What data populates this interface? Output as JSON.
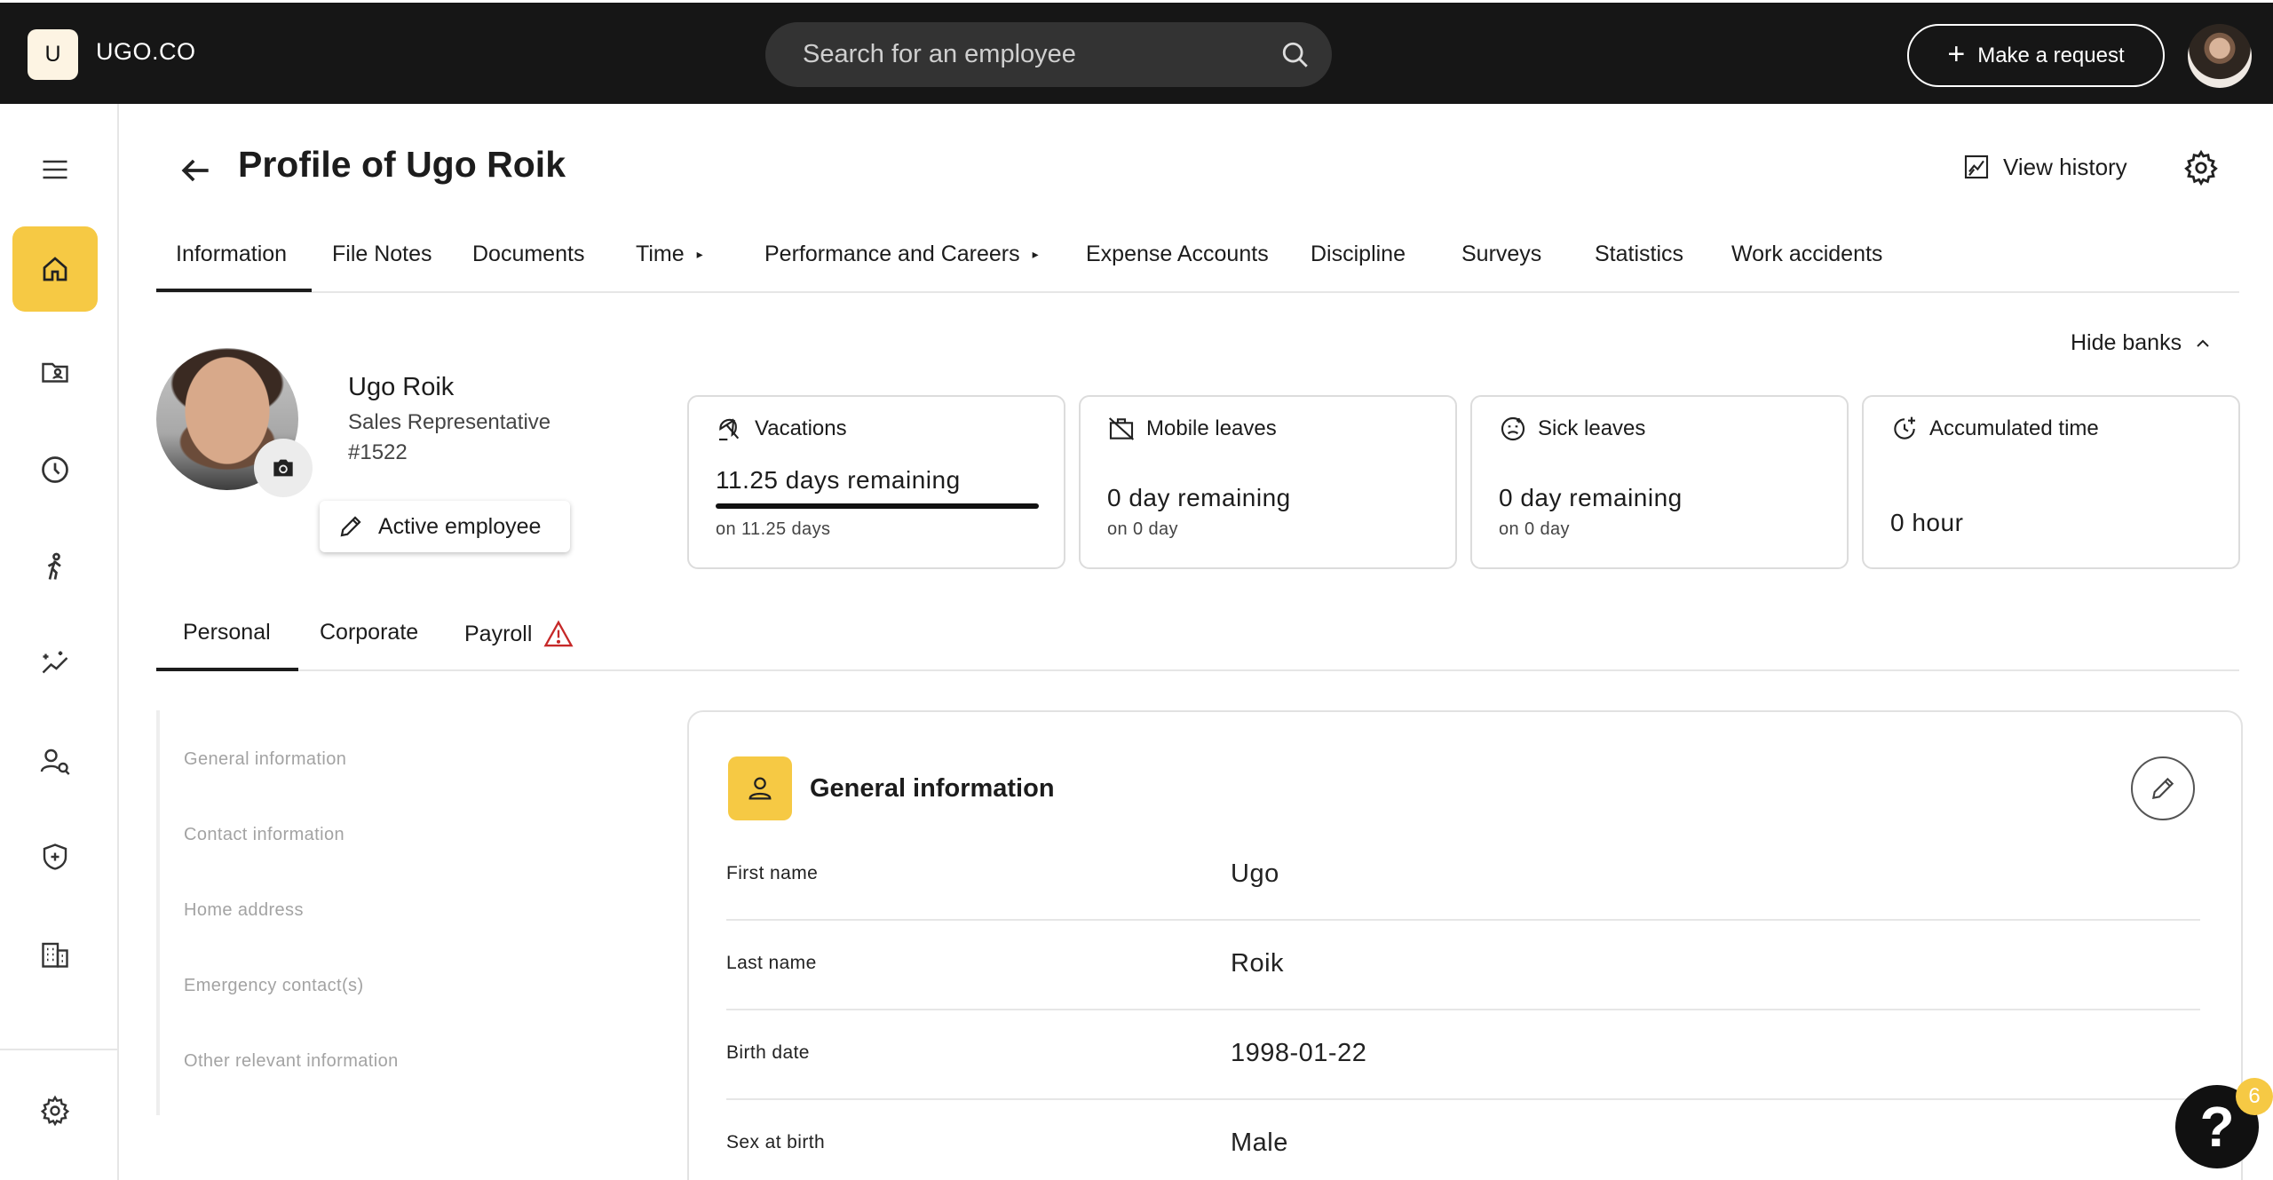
{
  "topbar": {
    "logo_letter": "U",
    "brand": "UGO.CO",
    "search_placeholder": "Search for an employee",
    "make_request": "Make a request"
  },
  "sidebar": {
    "items": [
      {
        "icon": "menu-icon"
      },
      {
        "icon": "home-icon",
        "active": true
      },
      {
        "icon": "folder-user-icon"
      },
      {
        "icon": "clock-icon"
      },
      {
        "icon": "person-activity-icon"
      },
      {
        "icon": "performance-sparkle-icon"
      },
      {
        "icon": "user-search-icon"
      },
      {
        "icon": "shield-plus-icon"
      },
      {
        "icon": "building-icon"
      },
      {
        "icon": "settings-icon"
      }
    ]
  },
  "header": {
    "title": "Profile of Ugo Roik",
    "view_history": "View history"
  },
  "main_tabs": [
    {
      "label": "Information",
      "active": true
    },
    {
      "label": "File Notes"
    },
    {
      "label": "Documents"
    },
    {
      "label": "Time",
      "caret": "▸"
    },
    {
      "label": "Performance and Careers",
      "caret": "▸"
    },
    {
      "label": "Expense Accounts"
    },
    {
      "label": "Discipline"
    },
    {
      "label": "Surveys"
    },
    {
      "label": "Statistics"
    },
    {
      "label": "Work accidents"
    }
  ],
  "hide_banks": "Hide banks",
  "employee": {
    "name": "Ugo Roik",
    "role": "Sales Representative",
    "id": "#1522",
    "status": "Active employee"
  },
  "banks": [
    {
      "title": "Vacations",
      "value": "11.25 days remaining",
      "sub": "on 11.25 days",
      "progress": 1.0
    },
    {
      "title": "Mobile leaves",
      "value": "0 day remaining",
      "sub": "on 0 day"
    },
    {
      "title": "Sick leaves",
      "value": "0 day remaining",
      "sub": "on 0 day"
    },
    {
      "title": "Accumulated time",
      "value": "0 hour"
    }
  ],
  "sub_tabs": [
    {
      "label": "Personal",
      "active": true
    },
    {
      "label": "Corporate"
    },
    {
      "label": "Payroll",
      "warning": true
    }
  ],
  "section_nav": [
    "General information",
    "Contact information",
    "Home address",
    "Emergency contact(s)",
    "Other relevant information"
  ],
  "general_info": {
    "title": "General information",
    "fields": [
      {
        "label": "First name",
        "value": "Ugo"
      },
      {
        "label": "Last name",
        "value": "Roik"
      },
      {
        "label": "Birth date",
        "value": "1998-01-22"
      },
      {
        "label": "Sex at birth",
        "value": "Male"
      }
    ]
  },
  "help": {
    "badge": "6"
  },
  "colors": {
    "accent": "#f6c944",
    "topbar": "#161616",
    "warning": "#c62828"
  }
}
